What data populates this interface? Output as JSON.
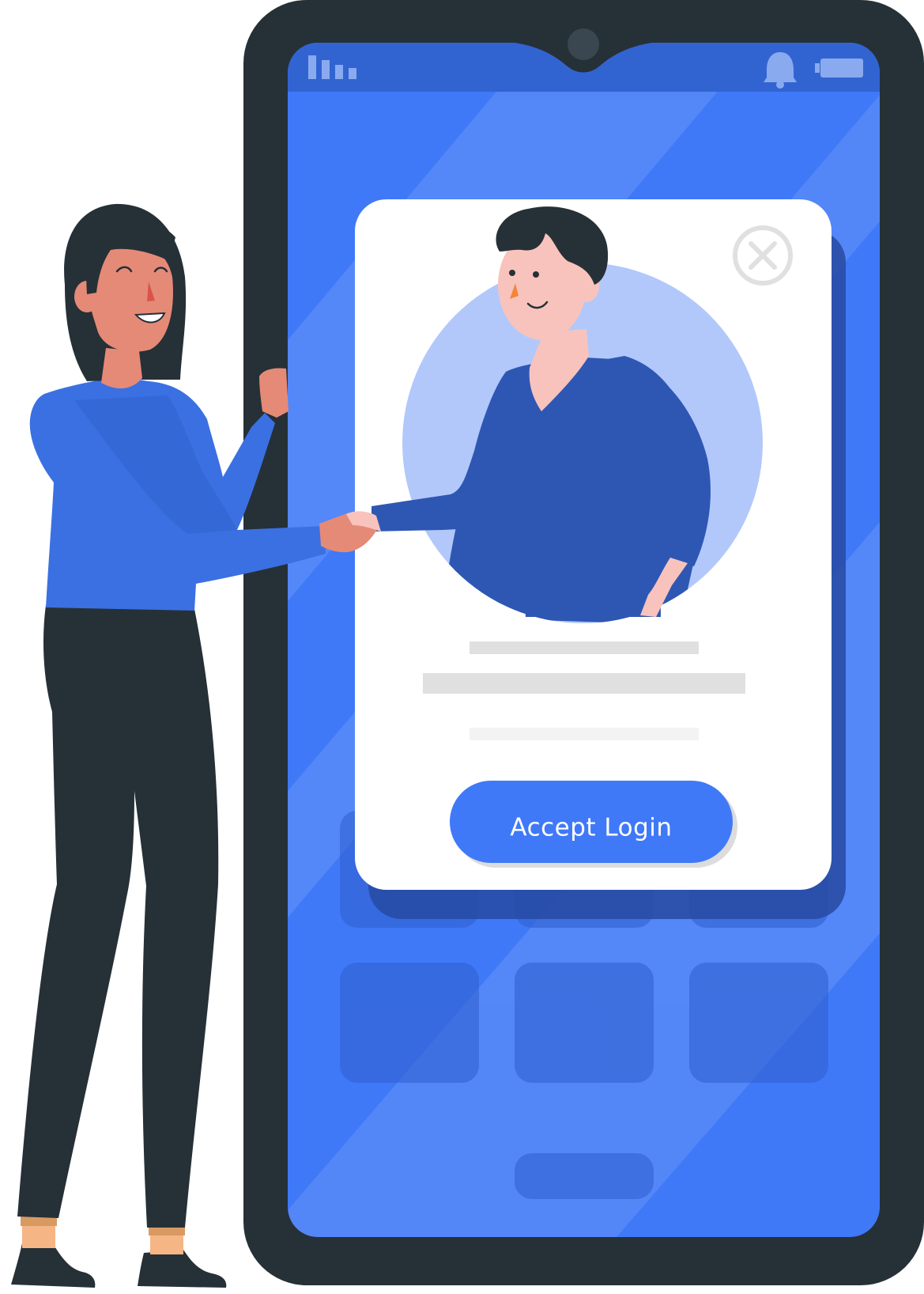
{
  "colors": {
    "phone_frame": "#263037",
    "screen": "#4079f7",
    "card": "#ffffff",
    "accept_button": "#4079f7",
    "avatar_circle": "#b2c8fb",
    "placeholder_lines": "#e0e0e0"
  },
  "status_bar": {
    "signal_icon": "signal-bars-icon",
    "bell_icon": "bell-icon",
    "battery_icon": "battery-icon"
  },
  "login_card": {
    "close_icon": "close-circle-icon",
    "accept_label": "Accept Login"
  }
}
